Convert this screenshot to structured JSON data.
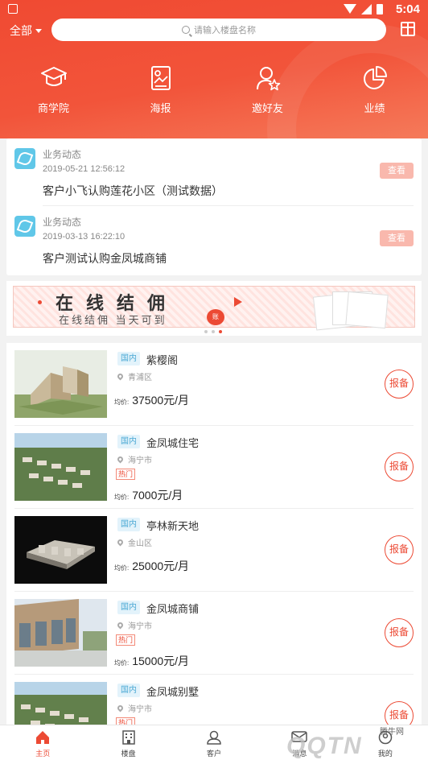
{
  "status_bar": {
    "time": "5:04"
  },
  "header": {
    "city_label": "全部",
    "search_placeholder": "请输入楼盘名称"
  },
  "quick_links": [
    {
      "label": "商学院",
      "icon": "graduation-cap-icon"
    },
    {
      "label": "海报",
      "icon": "poster-icon"
    },
    {
      "label": "邀好友",
      "icon": "invite-friend-icon"
    },
    {
      "label": "业绩",
      "icon": "pie-chart-icon"
    }
  ],
  "news": [
    {
      "type": "业务动态",
      "time": "2019-05-21 12:56:12",
      "content": "客户小飞认购莲花小区（测试数据）",
      "action": "查看"
    },
    {
      "type": "业务动态",
      "time": "2019-03-13 16:22:10",
      "content": "客户测试认购金凤城商铺",
      "action": "查看"
    }
  ],
  "banner": {
    "title": "在线结佣",
    "subtitle": "在线结佣 当天可到",
    "stamp": "账",
    "accent": "#ec4a34",
    "page_index": 2,
    "page_count": 3
  },
  "properties": [
    {
      "tag": "国内",
      "name": "紫樱阁",
      "location": "青浦区",
      "hot": "",
      "price_label": "均价:",
      "price": "37500元/月",
      "report": "报备"
    },
    {
      "tag": "国内",
      "name": "金凤城住宅",
      "location": "海宁市",
      "hot": "热门",
      "price_label": "均价:",
      "price": "7000元/月",
      "report": "报备"
    },
    {
      "tag": "国内",
      "name": "亭林新天地",
      "location": "金山区",
      "hot": "",
      "price_label": "均价:",
      "price": "25000元/月",
      "report": "报备"
    },
    {
      "tag": "国内",
      "name": "金凤城商铺",
      "location": "海宁市",
      "hot": "热门",
      "price_label": "均价:",
      "price": "15000元/月",
      "report": "报备"
    },
    {
      "tag": "国内",
      "name": "金凤城别墅",
      "location": "海宁市",
      "hot": "热门",
      "price_label": "",
      "price": "",
      "report": "报备"
    }
  ],
  "bottom_nav": [
    {
      "label": "主页",
      "icon": "home-icon",
      "active": true
    },
    {
      "label": "楼盘",
      "icon": "building-icon",
      "active": false
    },
    {
      "label": "客户",
      "icon": "customer-icon",
      "active": false
    },
    {
      "label": "消息",
      "icon": "message-icon",
      "active": false
    },
    {
      "label": "我的",
      "icon": "profile-icon",
      "active": false
    }
  ],
  "watermark": {
    "text": "腾牛网",
    "logo_text": "QQTN"
  }
}
